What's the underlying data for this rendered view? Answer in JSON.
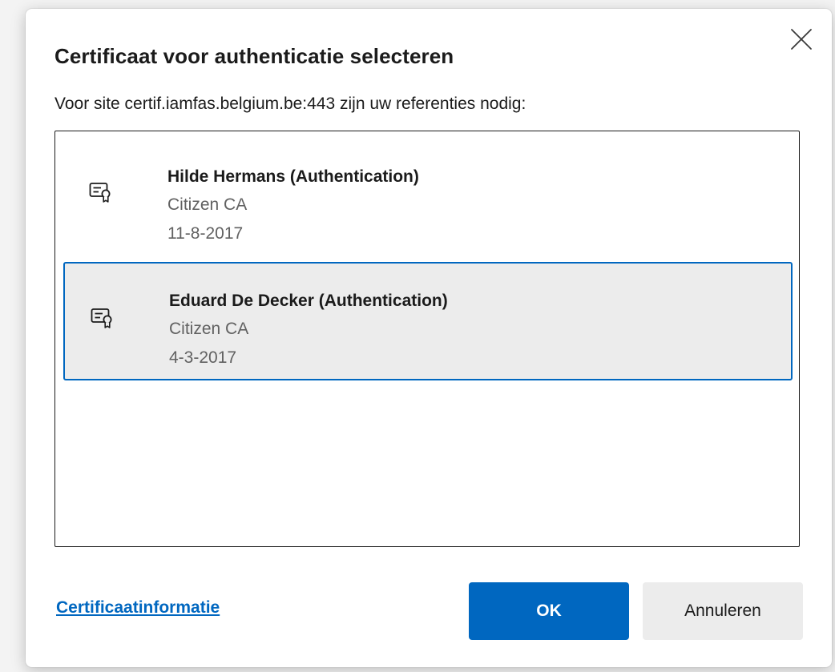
{
  "dialog": {
    "title": "Certificaat voor authenticatie selecteren",
    "subtitle": "Voor site certif.iamfas.belgium.be:443 zijn uw referenties nodig:",
    "close_icon": "close-icon",
    "certificates": [
      {
        "name": "Hilde Hermans (Authentication)",
        "issuer": "Citizen CA",
        "date": "11-8-2017",
        "icon": "certificate-icon",
        "selected": false
      },
      {
        "name": "Eduard De Decker (Authentication)",
        "issuer": "Citizen CA",
        "date": "4-3-2017",
        "icon": "certificate-icon",
        "selected": true
      }
    ],
    "cert_info_link": "Certificaatinformatie",
    "ok_label": "OK",
    "cancel_label": "Annuleren"
  },
  "colors": {
    "accent": "#0067c0",
    "selected_background": "#ececec",
    "secondary_text": "#616161"
  }
}
